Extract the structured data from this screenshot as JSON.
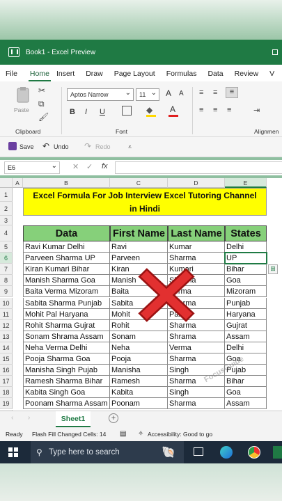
{
  "window": {
    "title": "Book1 - Excel Preview"
  },
  "menu": [
    "File",
    "Home",
    "Insert",
    "Draw",
    "Page Layout",
    "Formulas",
    "Data",
    "Review",
    "V"
  ],
  "ribbon": {
    "font_name": "Aptos Narrow",
    "font_size": "11",
    "clipboard_label": "Clipboard",
    "font_label": "Font",
    "alignment_label": "Alignmen",
    "paste_label": "Paste",
    "bold": "B",
    "italic": "I",
    "underline": "U",
    "grow": "A",
    "shrink": "A"
  },
  "qat": {
    "save": "Save",
    "undo": "Undo",
    "redo": "Redo"
  },
  "formula_bar": {
    "name_box": "E6",
    "fx": "fx"
  },
  "columns": [
    "A",
    "B",
    "C",
    "D",
    "E"
  ],
  "rows": [
    "1",
    "2",
    "3",
    "4",
    "5",
    "6",
    "7",
    "8",
    "9",
    "10",
    "11",
    "12",
    "13",
    "14",
    "15",
    "16",
    "17",
    "18",
    "19",
    "20"
  ],
  "banner": {
    "line1": "Excel Formula For Job Interview Excel Tutoring Channel",
    "line2": "in Hindi"
  },
  "headers": {
    "data": "Data",
    "first": "First Name",
    "last": "Last Name",
    "states": "States"
  },
  "table": [
    [
      "Ravi Kumar Delhi",
      "Ravi",
      "Kumar",
      "Delhi"
    ],
    [
      "Parveen Sharma UP",
      "Parveen",
      "Sharma",
      "UP"
    ],
    [
      "Kiran Kumari Bihar",
      "Kiran",
      "Kumari",
      "Bihar"
    ],
    [
      "Manish Sharma Goa",
      "Manish",
      "Sharma",
      "Goa"
    ],
    [
      "Baita Verma Mizoram",
      "Baita",
      "Verma",
      "Mizoram"
    ],
    [
      "Sabita Sharma Punjab",
      "Sabita",
      "Sharma",
      "Punjab"
    ],
    [
      "Mohit Pal Haryana",
      "Mohit",
      "Pal",
      "Haryana"
    ],
    [
      "Rohit Sharma Gujrat",
      "Rohit",
      "Sharma",
      "Gujrat"
    ],
    [
      "Sonam Shrama Assam",
      "Sonam",
      "Shrama",
      "Assam"
    ],
    [
      "Neha Verma Delhi",
      "Neha",
      "Verma",
      "Delhi"
    ],
    [
      "Pooja Sharma Goa",
      "Pooja",
      "Sharma",
      "Goa"
    ],
    [
      "Manisha Singh Pujab",
      "Manisha",
      "Singh",
      "Pujab"
    ],
    [
      "Ramesh Sharma Bihar",
      "Ramesh",
      "Sharma",
      "Bihar"
    ],
    [
      "Kabita Singh Goa",
      "Kabita",
      "Singh",
      "Goa"
    ],
    [
      "Poonam Sharma Assam",
      "Poonam",
      "Sharma",
      "Assam"
    ]
  ],
  "watermark": "FocusGuide",
  "sheet": {
    "tab": "Sheet1",
    "add": "+"
  },
  "status": {
    "ready": "Ready",
    "flash": "Flash Fill Changed Cells: 14",
    "accessibility": "Accessibility: Good to go"
  },
  "taskbar": {
    "search_placeholder": "Type here to search"
  },
  "colors": {
    "excel_green": "#1f7a44",
    "banner_yellow": "#ffff00",
    "header_green": "#86d07a",
    "x_red": "#e23030"
  }
}
